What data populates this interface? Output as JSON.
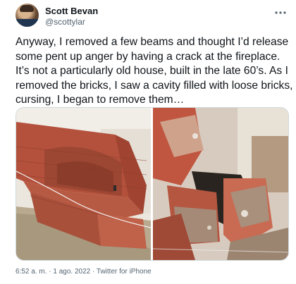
{
  "author": {
    "name": "Scott Bevan",
    "handle": "@scottylar"
  },
  "tweet": {
    "text": "Anyway, I removed a few beams and thought I’d release some pent up anger by having a crack at the fireplace. It’s not a particularly old house, built in the late 60’s. As I removed the bricks, I saw a cavity filled with loose bricks, cursing, I began to remove them…"
  },
  "meta": {
    "time": "6:52 a. m.",
    "separator": " · ",
    "date": "1 ago. 2022",
    "source": "Twitter for iPhone"
  },
  "icons": {
    "more": "more-options-icon"
  }
}
